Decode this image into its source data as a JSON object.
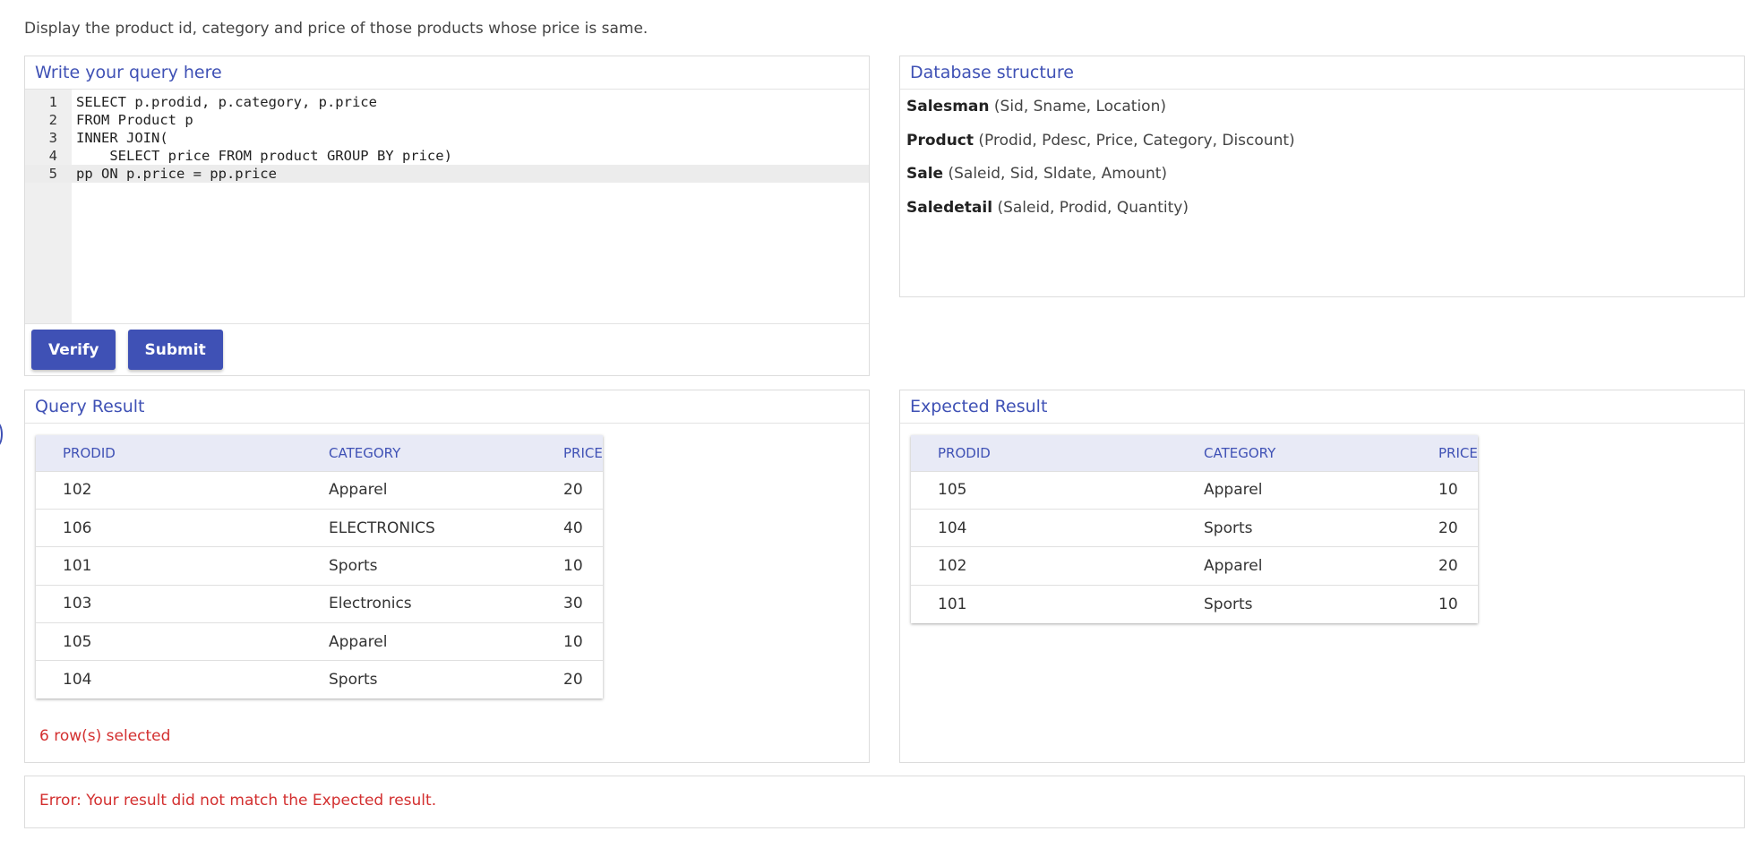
{
  "question": "Display the product id, category and price of those products whose price is same.",
  "editor": {
    "title": "Write your query here",
    "lines": [
      {
        "num": "1",
        "text": "SELECT p.prodid, p.category, p.price"
      },
      {
        "num": "2",
        "text": "FROM Product p"
      },
      {
        "num": "3",
        "text": "INNER JOIN("
      },
      {
        "num": "4",
        "text": "    SELECT price FROM product GROUP BY price)"
      },
      {
        "num": "5",
        "text": "pp ON p.price = pp.price"
      }
    ],
    "active_line": 5,
    "verify_label": "Verify",
    "submit_label": "Submit"
  },
  "database": {
    "title": "Database structure",
    "tables": [
      {
        "name": "Salesman",
        "columns": "(Sid, Sname, Location)"
      },
      {
        "name": "Product",
        "columns": "(Prodid, Pdesc, Price, Category, Discount)"
      },
      {
        "name": "Sale",
        "columns": "(Saleid, Sid, Sldate, Amount)"
      },
      {
        "name": "Saledetail",
        "columns": "(Saleid, Prodid, Quantity)"
      }
    ]
  },
  "query_result": {
    "title": "Query Result",
    "headers": [
      "PRODID",
      "CATEGORY",
      "PRICE"
    ],
    "rows": [
      [
        "102",
        "Apparel",
        "20"
      ],
      [
        "106",
        "ELECTRONICS",
        "40"
      ],
      [
        "101",
        "Sports",
        "10"
      ],
      [
        "103",
        "Electronics",
        "30"
      ],
      [
        "105",
        "Apparel",
        "10"
      ],
      [
        "104",
        "Sports",
        "20"
      ]
    ],
    "row_count": "6 row(s) selected"
  },
  "expected_result": {
    "title": "Expected Result",
    "headers": [
      "PRODID",
      "CATEGORY",
      "PRICE"
    ],
    "rows": [
      [
        "105",
        "Apparel",
        "10"
      ],
      [
        "104",
        "Sports",
        "20"
      ],
      [
        "102",
        "Apparel",
        "20"
      ],
      [
        "101",
        "Sports",
        "10"
      ]
    ]
  },
  "error_message": "Error: Your result did not match the Expected result.",
  "colors": {
    "accent": "#3f51b5",
    "error": "#d32f2f",
    "table_header_bg": "#e8eaf6"
  }
}
